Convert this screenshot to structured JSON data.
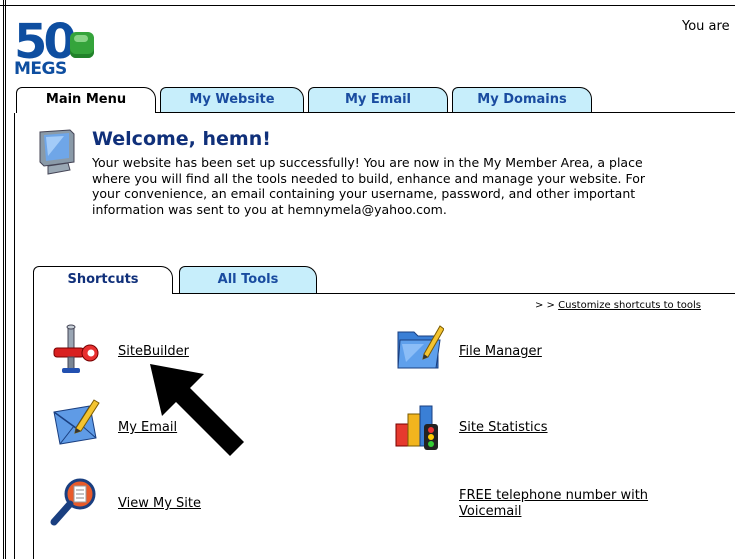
{
  "header": {
    "logo_number": "50",
    "logo_word": "MEGS",
    "top_right_text": "You are"
  },
  "main_tabs": [
    {
      "label": "Main Menu",
      "active": true
    },
    {
      "label": "My Website",
      "active": false
    },
    {
      "label": "My Email",
      "active": false
    },
    {
      "label": "My Domains",
      "active": false
    }
  ],
  "welcome": {
    "title": "Welcome, hemn!",
    "lines": [
      "Your website has been set up successfully! You are now in the My Member Area, a place",
      "where you will find all the tools needed to build, enhance and manage your website. For",
      "your convenience, an email containing your username, password, and other important",
      "information was sent to you at hemnymela@yahoo.com."
    ]
  },
  "sub_tabs": [
    {
      "label": "Shortcuts",
      "active": true
    },
    {
      "label": "All Tools",
      "active": false
    }
  ],
  "customize": {
    "prefix": "> > ",
    "link": "Customize shortcuts to tools"
  },
  "shortcuts": {
    "sitebuilder": {
      "label": "SiteBuilder",
      "icon": "sitebuilder-icon"
    },
    "file_manager": {
      "label": "File Manager",
      "icon": "file-manager-icon"
    },
    "my_email": {
      "label": "My Email",
      "icon": "email-icon"
    },
    "site_statistics": {
      "label": "Site Statistics",
      "icon": "statistics-icon"
    },
    "view_my_site": {
      "label": "View My Site",
      "icon": "view-site-icon"
    },
    "telephone": {
      "line1": "FREE telephone number with",
      "line2": "Voicemail"
    }
  },
  "colors": {
    "brand_blue": "#0e4ea0",
    "brand_green": "#35a43b",
    "inactive_tab": "#c7eefb",
    "title_navy": "#10307a"
  }
}
